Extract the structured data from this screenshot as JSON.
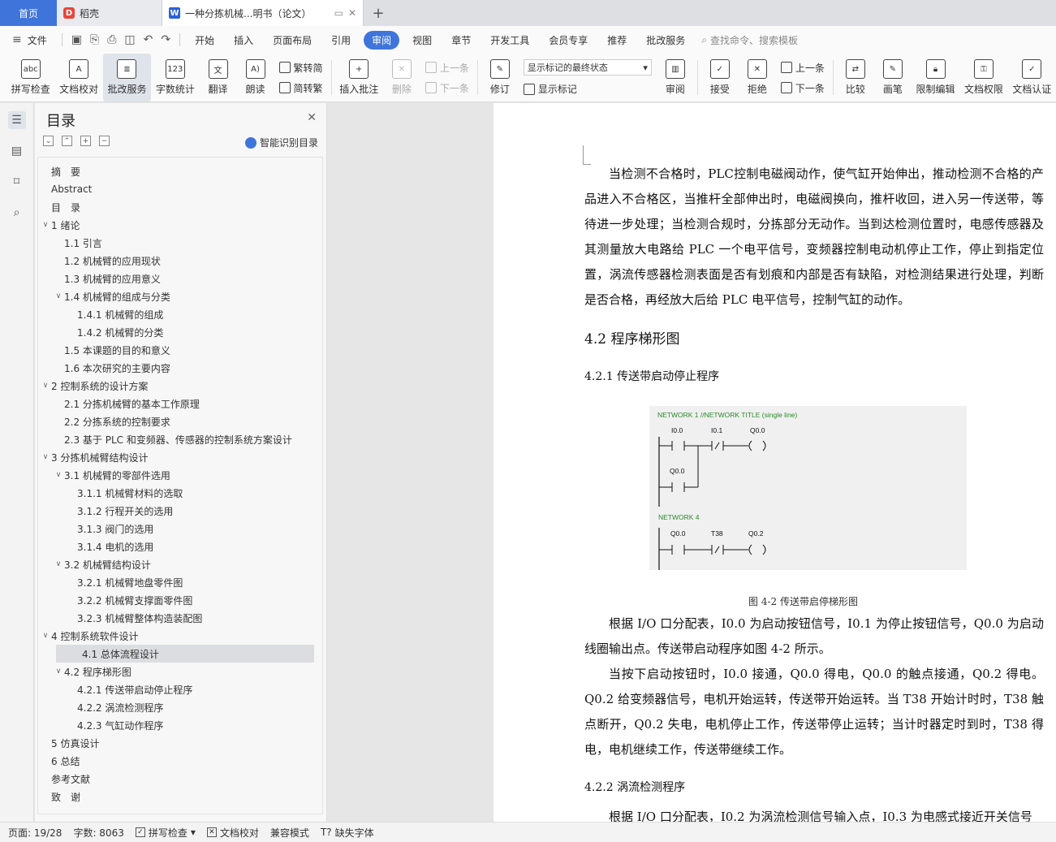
{
  "tabs": {
    "home": "首页",
    "daoke": "稻壳",
    "doc": "一种分拣机械...明书（论文）"
  },
  "menu": {
    "file": "文件",
    "items": [
      "开始",
      "插入",
      "页面布局",
      "引用",
      "审阅",
      "视图",
      "章节",
      "开发工具",
      "会员专享",
      "推荐",
      "批改服务"
    ],
    "active_index": 4,
    "search": "查找命令、搜索模板"
  },
  "ribbon": {
    "spellcheck": "拼写检查",
    "proof": "文档校对",
    "review_service": "批改服务",
    "wordcount": "字数统计",
    "translate": "翻译",
    "read": "朗读",
    "to_traditional": "繁转简",
    "to_simplified": "简转繁",
    "insert_comment": "插入批注",
    "delete": "删除",
    "prev": "上一条",
    "next": "下一条",
    "revise": "修订",
    "markup_state": "显示标记的最终状态",
    "show_markup": "显示标记",
    "review": "审阅",
    "accept": "接受",
    "reject": "拒绝",
    "prev2": "上一条",
    "next2": "下一条",
    "compare": "比较",
    "pen": "画笔",
    "restrict": "限制编辑",
    "permission": "文档权限",
    "certify": "文档认证"
  },
  "toc": {
    "title": "目录",
    "smart": "智能识别目录",
    "items": [
      {
        "text": "摘　要",
        "level": 1,
        "arrow": ""
      },
      {
        "text": "Abstract",
        "level": 1,
        "arrow": ""
      },
      {
        "text": "目　录",
        "level": 1,
        "arrow": ""
      },
      {
        "text": "1  绪论",
        "level": 1,
        "arrow": "v"
      },
      {
        "text": "1.1 引言",
        "level": 2,
        "arrow": ""
      },
      {
        "text": "1.2  机械臂的应用现状",
        "level": 2,
        "arrow": ""
      },
      {
        "text": "1.3  机械臂的应用意义",
        "level": 2,
        "arrow": ""
      },
      {
        "text": "1.4 机械臂的组成与分类",
        "level": 2,
        "arrow": "v"
      },
      {
        "text": "1.4.1 机械臂的组成",
        "level": 3,
        "arrow": ""
      },
      {
        "text": "1.4.2 机械臂的分类",
        "level": 3,
        "arrow": ""
      },
      {
        "text": "1.5 本课题的目的和意义",
        "level": 2,
        "arrow": ""
      },
      {
        "text": "1.6  本次研究的主要内容",
        "level": 2,
        "arrow": ""
      },
      {
        "text": "2  控制系统的设计方案",
        "level": 1,
        "arrow": "v"
      },
      {
        "text": "2.1 分拣机械臂的基本工作原理",
        "level": 2,
        "arrow": ""
      },
      {
        "text": "2.2 分拣系统的控制要求",
        "level": 2,
        "arrow": ""
      },
      {
        "text": "2.3 基于 PLC 和变频器、传感器的控制系统方案设计",
        "level": 2,
        "arrow": ""
      },
      {
        "text": "3  分拣机械臂结构设计",
        "level": 1,
        "arrow": "v"
      },
      {
        "text": "3.1 机械臂的零部件选用",
        "level": 2,
        "arrow": "v"
      },
      {
        "text": "3.1.1 机械臂材料的选取",
        "level": 3,
        "arrow": ""
      },
      {
        "text": "3.1.2 行程开关的选用",
        "level": 3,
        "arrow": ""
      },
      {
        "text": "3.1.3  阀门的选用",
        "level": 3,
        "arrow": ""
      },
      {
        "text": "3.1.4  电机的选用",
        "level": 3,
        "arrow": ""
      },
      {
        "text": "3.2 机械臂结构设计",
        "level": 2,
        "arrow": "v"
      },
      {
        "text": "3.2.1 机械臂地盘零件图",
        "level": 3,
        "arrow": ""
      },
      {
        "text": "3.2.2 机械臂支撑面零件图",
        "level": 3,
        "arrow": ""
      },
      {
        "text": "3.2.3 机械臂整体构造装配图",
        "level": 3,
        "arrow": ""
      },
      {
        "text": "4  控制系统软件设计",
        "level": 1,
        "arrow": "v"
      },
      {
        "text": "4.1 总体流程设计",
        "level": 2,
        "arrow": "",
        "selected": true
      },
      {
        "text": "4.2 程序梯形图",
        "level": 2,
        "arrow": "v"
      },
      {
        "text": "4.2.1 传送带启动停止程序",
        "level": 3,
        "arrow": ""
      },
      {
        "text": "4.2.2 涡流检测程序",
        "level": 3,
        "arrow": ""
      },
      {
        "text": "4.2.3 气缸动作程序",
        "level": 3,
        "arrow": ""
      },
      {
        "text": "5  仿真设计",
        "level": 1,
        "arrow": ""
      },
      {
        "text": "6  总结",
        "level": 1,
        "arrow": ""
      },
      {
        "text": "参考文献",
        "level": 1,
        "arrow": ""
      },
      {
        "text": "致　谢",
        "level": 1,
        "arrow": ""
      }
    ]
  },
  "document": {
    "para1": "当检测不合格时，PLC控制电磁阀动作，使气缸开始伸出，推动检测不合格的产品进入不合格区，当推杆全部伸出时，电磁阀换向，推杆收回，进入另一传送带，等待进一步处理；当检测合规时，分拣部分无动作。当到达检测位置时，电感传感器及其测量放大电路给 PLC 一个电平信号，变频器控制电动机停止工作，停止到指定位置，涡流传感器检测表面是否有划痕和内部是否有缺陷，对检测结果进行处理，判断是否合格，再经放大后给 PLC 电平信号，控制气缸的动作。",
    "h42": "4.2 程序梯形图",
    "h421": "4.2.1 传送带启动停止程序",
    "caption": "图 4-2  传送带启停梯形图",
    "para2": "根据 I/O 口分配表，I0.0 为启动按钮信号，I0.1 为停止按钮信号，Q0.0 为启动线圈输出点。传送带启动程序如图 4-2 所示。",
    "para3": "当按下启动按钮时，I0.0 接通，Q0.0 得电，Q0.0 的触点接通，Q0.2 得电。Q0.2 给变频器信号，电机开始运转，传送带开始运转。当 T38 开始计时时，T38 触点断开，Q0.2 失电，电机停止工作，传送带停止运转；当计时器定时到时，T38 得电，电机继续工作，传送带继续工作。",
    "h422": "4.2.2 涡流检测程序",
    "para4": "根据 I/O 口分配表，I0.2 为涡流检测信号输入点，I0.3 为电感式接近开关信号"
  },
  "ladder": {
    "net1": "NETWORK 1 //NETWORK TITLE (single line)",
    "net4": "NETWORK 4",
    "i00": "I0.0",
    "i01": "I0.1",
    "q00a": "Q0.0",
    "q00b": "Q0.0",
    "q00c": "Q0.0",
    "t38": "T38",
    "q02": "Q0.2",
    "green": "#2a8a2a"
  },
  "status": {
    "page": "页面: 19/28",
    "words": "字数: 8063",
    "spell": "拼写检查",
    "proof": "文档校对",
    "compat": "兼容模式",
    "missing_font": "缺失字体"
  }
}
